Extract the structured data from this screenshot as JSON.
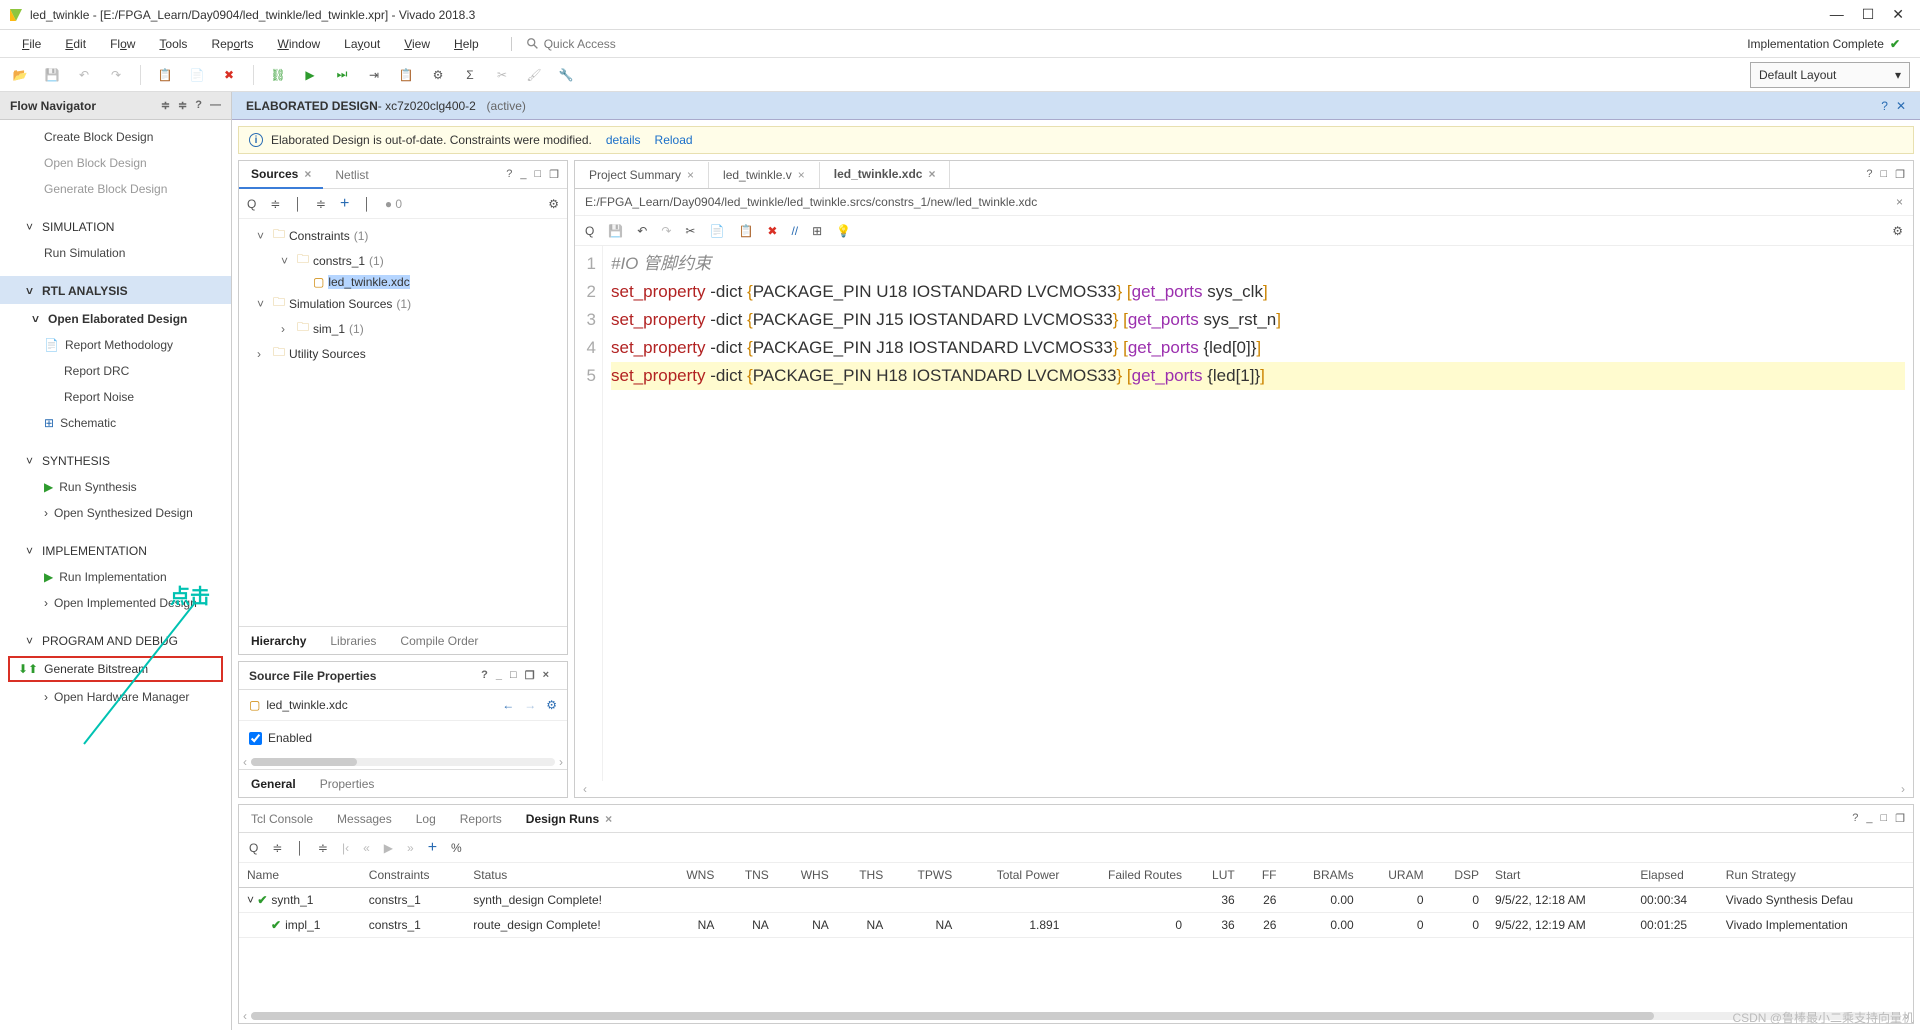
{
  "window": {
    "title": "led_twinkle - [E:/FPGA_Learn/Day0904/led_twinkle/led_twinkle.xpr] - Vivado 2018.3"
  },
  "menu": [
    "File",
    "Edit",
    "Flow",
    "Tools",
    "Reports",
    "Window",
    "Layout",
    "View",
    "Help"
  ],
  "quick_access": {
    "placeholder": "Quick Access"
  },
  "status": {
    "label": "Implementation Complete"
  },
  "layout_dd": {
    "value": "Default Layout"
  },
  "flow_nav": {
    "title": "Flow Navigator",
    "ip": {
      "create": "Create Block Design",
      "open": "Open Block Design",
      "gen": "Generate Block Design"
    },
    "sim": {
      "hdr": "SIMULATION",
      "run": "Run Simulation"
    },
    "rtl": {
      "hdr": "RTL ANALYSIS",
      "open": "Open Elaborated Design",
      "meth": "Report Methodology",
      "drc": "Report DRC",
      "noise": "Report Noise",
      "schem": "Schematic"
    },
    "syn": {
      "hdr": "SYNTHESIS",
      "run": "Run Synthesis",
      "open": "Open Synthesized Design"
    },
    "impl": {
      "hdr": "IMPLEMENTATION",
      "run": "Run Implementation",
      "open": "Open Implemented Design"
    },
    "prog": {
      "hdr": "PROGRAM AND DEBUG",
      "gen": "Generate Bitstream",
      "hw": "Open Hardware Manager"
    }
  },
  "elab": {
    "label": "ELABORATED DESIGN",
    "part": " - xc7z020clg400-2",
    "active": "(active)"
  },
  "notice": {
    "msg": "Elaborated Design is out-of-date. Constraints were modified.",
    "details": "details",
    "reload": "Reload"
  },
  "sources": {
    "tabs": {
      "sources": "Sources",
      "netlist": "Netlist"
    },
    "tree": {
      "constraints": "Constraints",
      "constraints_cnt": "(1)",
      "constrs": "constrs_1",
      "constrs_cnt": "(1)",
      "xdc": "led_twinkle.xdc",
      "simsrc": "Simulation Sources",
      "simsrc_cnt": "(1)",
      "sim1": "sim_1",
      "sim1_cnt": "(1)",
      "util": "Utility Sources"
    },
    "btabs": {
      "hier": "Hierarchy",
      "lib": "Libraries",
      "comp": "Compile Order"
    }
  },
  "props": {
    "title": "Source File Properties",
    "file": "led_twinkle.xdc",
    "enabled": "Enabled",
    "tabs": {
      "gen": "General",
      "props": "Properties"
    }
  },
  "editor": {
    "tabs": {
      "summary": "Project Summary",
      "v": "led_twinkle.v",
      "xdc": "led_twinkle.xdc"
    },
    "path": "E:/FPGA_Learn/Day0904/led_twinkle/led_twinkle.srcs/constrs_1/new/led_twinkle.xdc",
    "code": {
      "l1": "#IO 管脚约束",
      "l2a": "set_property",
      "l2b": " -dict ",
      "l2c": "{",
      "l2d": "PACKAGE_PIN U18 IOSTANDARD LVCMOS33",
      "l2e": "}",
      "l2f": " [",
      "l2g": "get_ports",
      "l2h": " sys_clk",
      "l2i": "]",
      "l3d": "PACKAGE_PIN J15 IOSTANDARD LVCMOS33",
      "l3h": " sys_rst_n",
      "l4d": "PACKAGE_PIN J18 IOSTANDARD LVCMOS33",
      "l4h": " {led[0]}",
      "l5d": "PACKAGE_PIN H18 IOSTANDARD LVCMOS33",
      "l5h": " {led[1]}"
    }
  },
  "bottom": {
    "tabs": {
      "tcl": "Tcl Console",
      "msg": "Messages",
      "log": "Log",
      "rep": "Reports",
      "runs": "Design Runs"
    },
    "cols": {
      "name": "Name",
      "cons": "Constraints",
      "stat": "Status",
      "wns": "WNS",
      "tns": "TNS",
      "whs": "WHS",
      "ths": "THS",
      "tpws": "TPWS",
      "tp": "Total Power",
      "fr": "Failed Routes",
      "lut": "LUT",
      "ff": "FF",
      "brams": "BRAMs",
      "uram": "URAM",
      "dsp": "DSP",
      "start": "Start",
      "elapsed": "Elapsed",
      "strat": "Run Strategy"
    },
    "r1": {
      "name": "synth_1",
      "cons": "constrs_1",
      "stat": "synth_design Complete!",
      "lut": "36",
      "ff": "26",
      "brams": "0.00",
      "uram": "0",
      "dsp": "0",
      "start": "9/5/22, 12:18 AM",
      "elapsed": "00:00:34",
      "strat": "Vivado Synthesis Defau"
    },
    "r2": {
      "name": "impl_1",
      "cons": "constrs_1",
      "stat": "route_design Complete!",
      "wns": "NA",
      "tns": "NA",
      "whs": "NA",
      "ths": "NA",
      "tpws": "NA",
      "tp": "1.891",
      "fr": "0",
      "lut": "36",
      "ff": "26",
      "brams": "0.00",
      "uram": "0",
      "dsp": "0",
      "start": "9/5/22, 12:19 AM",
      "elapsed": "00:01:25",
      "strat": "Vivado Implementation"
    }
  },
  "annot": {
    "text": "点击"
  },
  "watermark": {
    "text": "CSDN @鲁棒最小二乘支持向量机"
  }
}
